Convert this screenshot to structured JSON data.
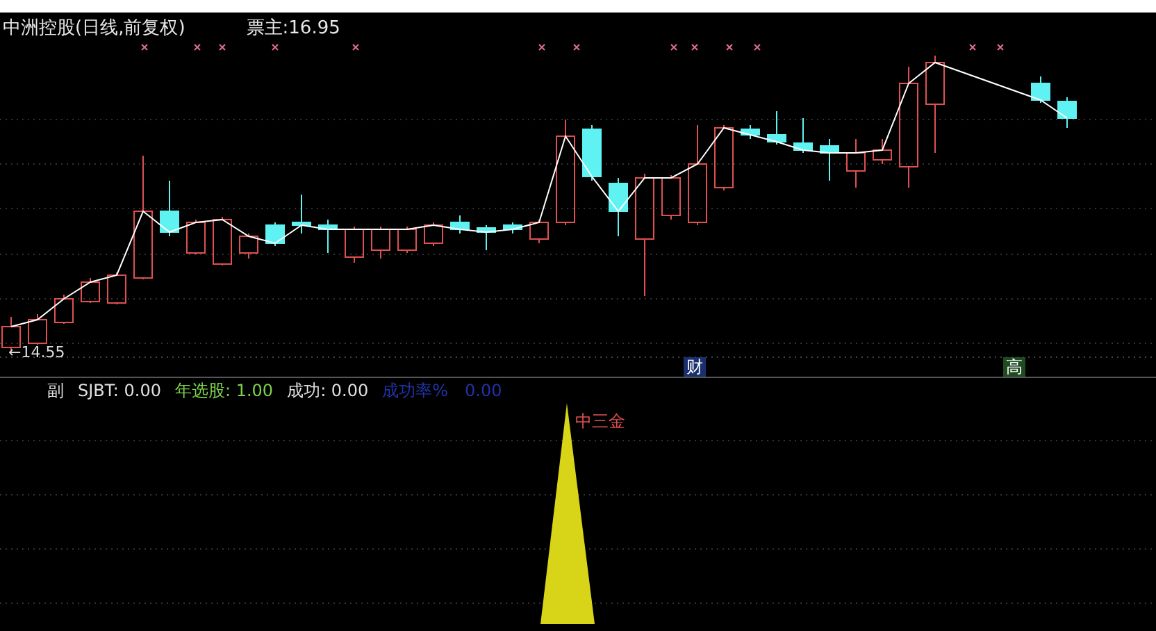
{
  "header": {
    "title": "中洲控股(日线,前复权)",
    "reading": "票主:16.95"
  },
  "main_chart": {
    "low_marker": "←14.55",
    "badges": [
      {
        "text": "财",
        "color": "#1a2f6e"
      },
      {
        "text": "高",
        "color": "#1f4a22"
      }
    ]
  },
  "sub_panel": {
    "legend": [
      {
        "text": "副",
        "color": "#e0e0e0"
      },
      {
        "text": "SJBT: 0.00",
        "color": "#e0e0e0"
      },
      {
        "text": "年选股: 1.00",
        "color": "#7cd34a"
      },
      {
        "text": "成功: 0.00",
        "color": "#e0e0e0"
      },
      {
        "text": "成功率%",
        "color": "#2233a8"
      },
      {
        "text": "0.00",
        "color": "#2233a8"
      }
    ],
    "signal_label": "中三金"
  }
}
